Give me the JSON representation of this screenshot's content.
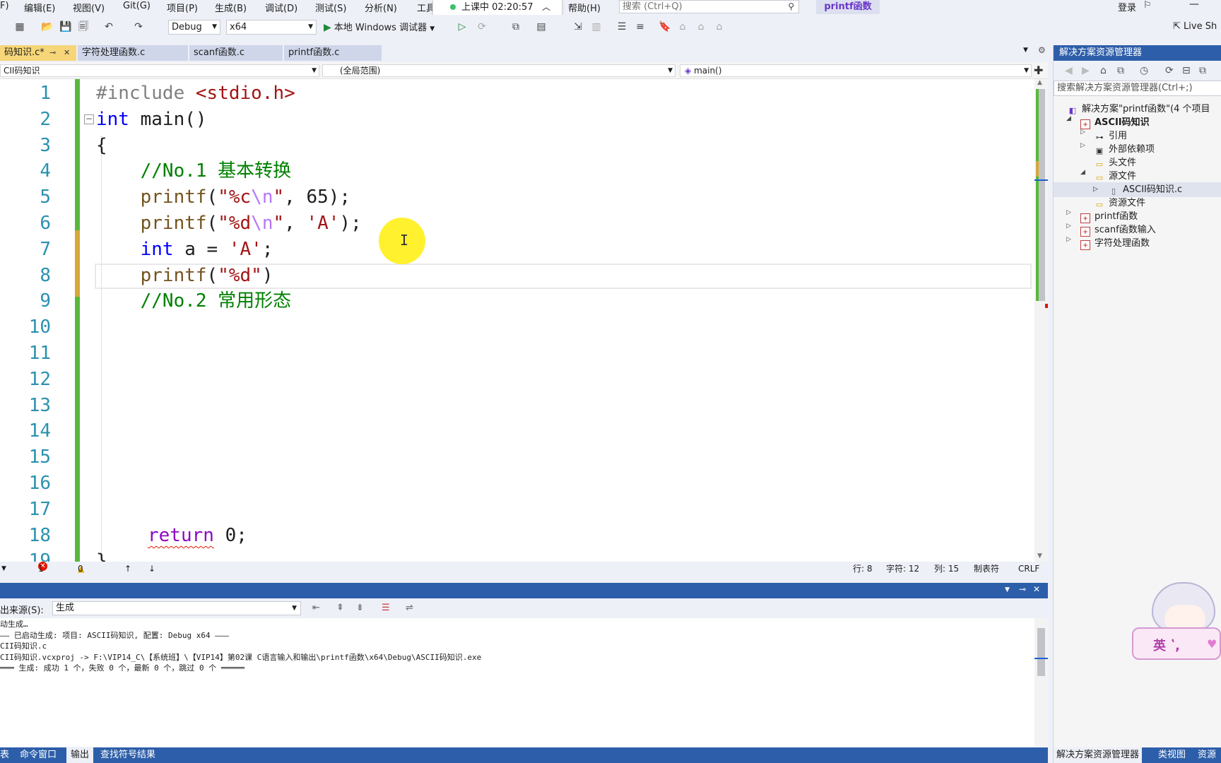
{
  "menu": {
    "items": [
      "F)",
      "编辑(E)",
      "视图(V)",
      "Git(G)",
      "项目(P)",
      "生成(B)",
      "调试(D)",
      "测试(S)",
      "分析(N)",
      "工具",
      "帮助(H)"
    ],
    "search_placeholder": "搜索 (Ctrl+Q)",
    "solution_name": "printf函数",
    "class_status": "上课中 02:20:57",
    "login": "登录"
  },
  "toolbar": {
    "config": "Debug",
    "platform": "x64",
    "run_label": "本地 Windows 调试器",
    "live_share": "Live Sh"
  },
  "tabs": [
    {
      "label": "码知识.c*",
      "active": true
    },
    {
      "label": "字符处理函数.c",
      "active": false
    },
    {
      "label": "scanf函数.c",
      "active": false
    },
    {
      "label": "printf函数.c",
      "active": false
    }
  ],
  "navbar": {
    "project": "CII码知识",
    "scope": "(全局范围)",
    "member": "main()"
  },
  "editor": {
    "line_numbers": [
      "1",
      "2",
      "3",
      "4",
      "5",
      "6",
      "7",
      "8",
      "9",
      "10",
      "11",
      "12",
      "13",
      "14",
      "15",
      "16",
      "17",
      "18",
      "19"
    ],
    "code": {
      "l1_pre": "#include ",
      "l1_inc": "<stdio.h>",
      "l2_kw": "int",
      "l2_rest": " main()",
      "l3": "{",
      "l4_com": "    //No.1 基本转换",
      "l5_fn": "    printf",
      "l5_a": "(",
      "l5_s1": "\"%c",
      "l5_esc": "\\n",
      "l5_s2": "\"",
      "l5_rest": ", 65);",
      "l6_fn": "    printf",
      "l6_a": "(",
      "l6_s1": "\"%d",
      "l6_esc": "\\n",
      "l6_s2": "\"",
      "l6_mid": ", ",
      "l6_ch": "'A'",
      "l6_rest": ");",
      "l7_kw": "    int",
      "l7_mid": " a = ",
      "l7_ch": "'A'",
      "l7_rest": ";",
      "l8_fn": "    printf",
      "l8_a": "(",
      "l8_s": "\"%d\"",
      "l8_rest": ")",
      "l9_com": "    //No.2 常用形态",
      "l18_ret": "return",
      "l18_rest": " 0;",
      "l19": "}"
    }
  },
  "status": {
    "errors": "1",
    "warnings": "0",
    "line": "行: 8",
    "char": "字符: 12",
    "col": "列: 15",
    "tab": "制表符",
    "eol": "CRLF"
  },
  "output": {
    "source_label": "出来源(S):",
    "source_value": "生成",
    "lines": [
      "动生成…",
      "—— 已启动生成: 项目: ASCII码知识, 配置: Debug x64 ———",
      "CII码知识.c",
      "CII码知识.vcxproj -> F:\\VIP14_C\\【系统班】\\【VIP14】第02课 C语言输入和输出\\printf函数\\x64\\Debug\\ASCII码知识.exe",
      "═══ 生成: 成功 1 个，失败 0 个，最新 0 个，跳过 0 个 ═════"
    ]
  },
  "bottom_tabs": [
    "表",
    "命令窗口",
    "输出",
    "查找符号结果"
  ],
  "solution_explorer": {
    "title": "解决方案资源管理器",
    "search_placeholder": "搜索解决方案资源管理器(Ctrl+;)",
    "tree": [
      {
        "label": "解决方案\"printf函数\"(4 个项目",
        "icon": "solution-icon"
      },
      {
        "label": "ASCII码知识",
        "icon": "project-icon"
      },
      {
        "label": "引用",
        "icon": "references-icon"
      },
      {
        "label": "外部依赖项",
        "icon": "external-deps-icon"
      },
      {
        "label": "头文件",
        "icon": "folder-icon"
      },
      {
        "label": "源文件",
        "icon": "folder-icon"
      },
      {
        "label": "ASCII码知识.c",
        "icon": "c-file-icon"
      },
      {
        "label": "资源文件",
        "icon": "folder-icon"
      },
      {
        "label": "printf函数",
        "icon": "project-icon"
      },
      {
        "label": "scanf函数输入",
        "icon": "project-icon"
      },
      {
        "label": "字符处理函数",
        "icon": "project-icon"
      }
    ],
    "bottom_tabs": [
      "解决方案资源管理器",
      "类视图",
      "资源"
    ]
  },
  "mascot": {
    "text": "英 ʽ,"
  },
  "colors": {
    "accent": "#2d5ea9",
    "active_tab": "#f6d678",
    "keyword": "#0000ff",
    "string": "#a31515",
    "comment": "#008000"
  }
}
